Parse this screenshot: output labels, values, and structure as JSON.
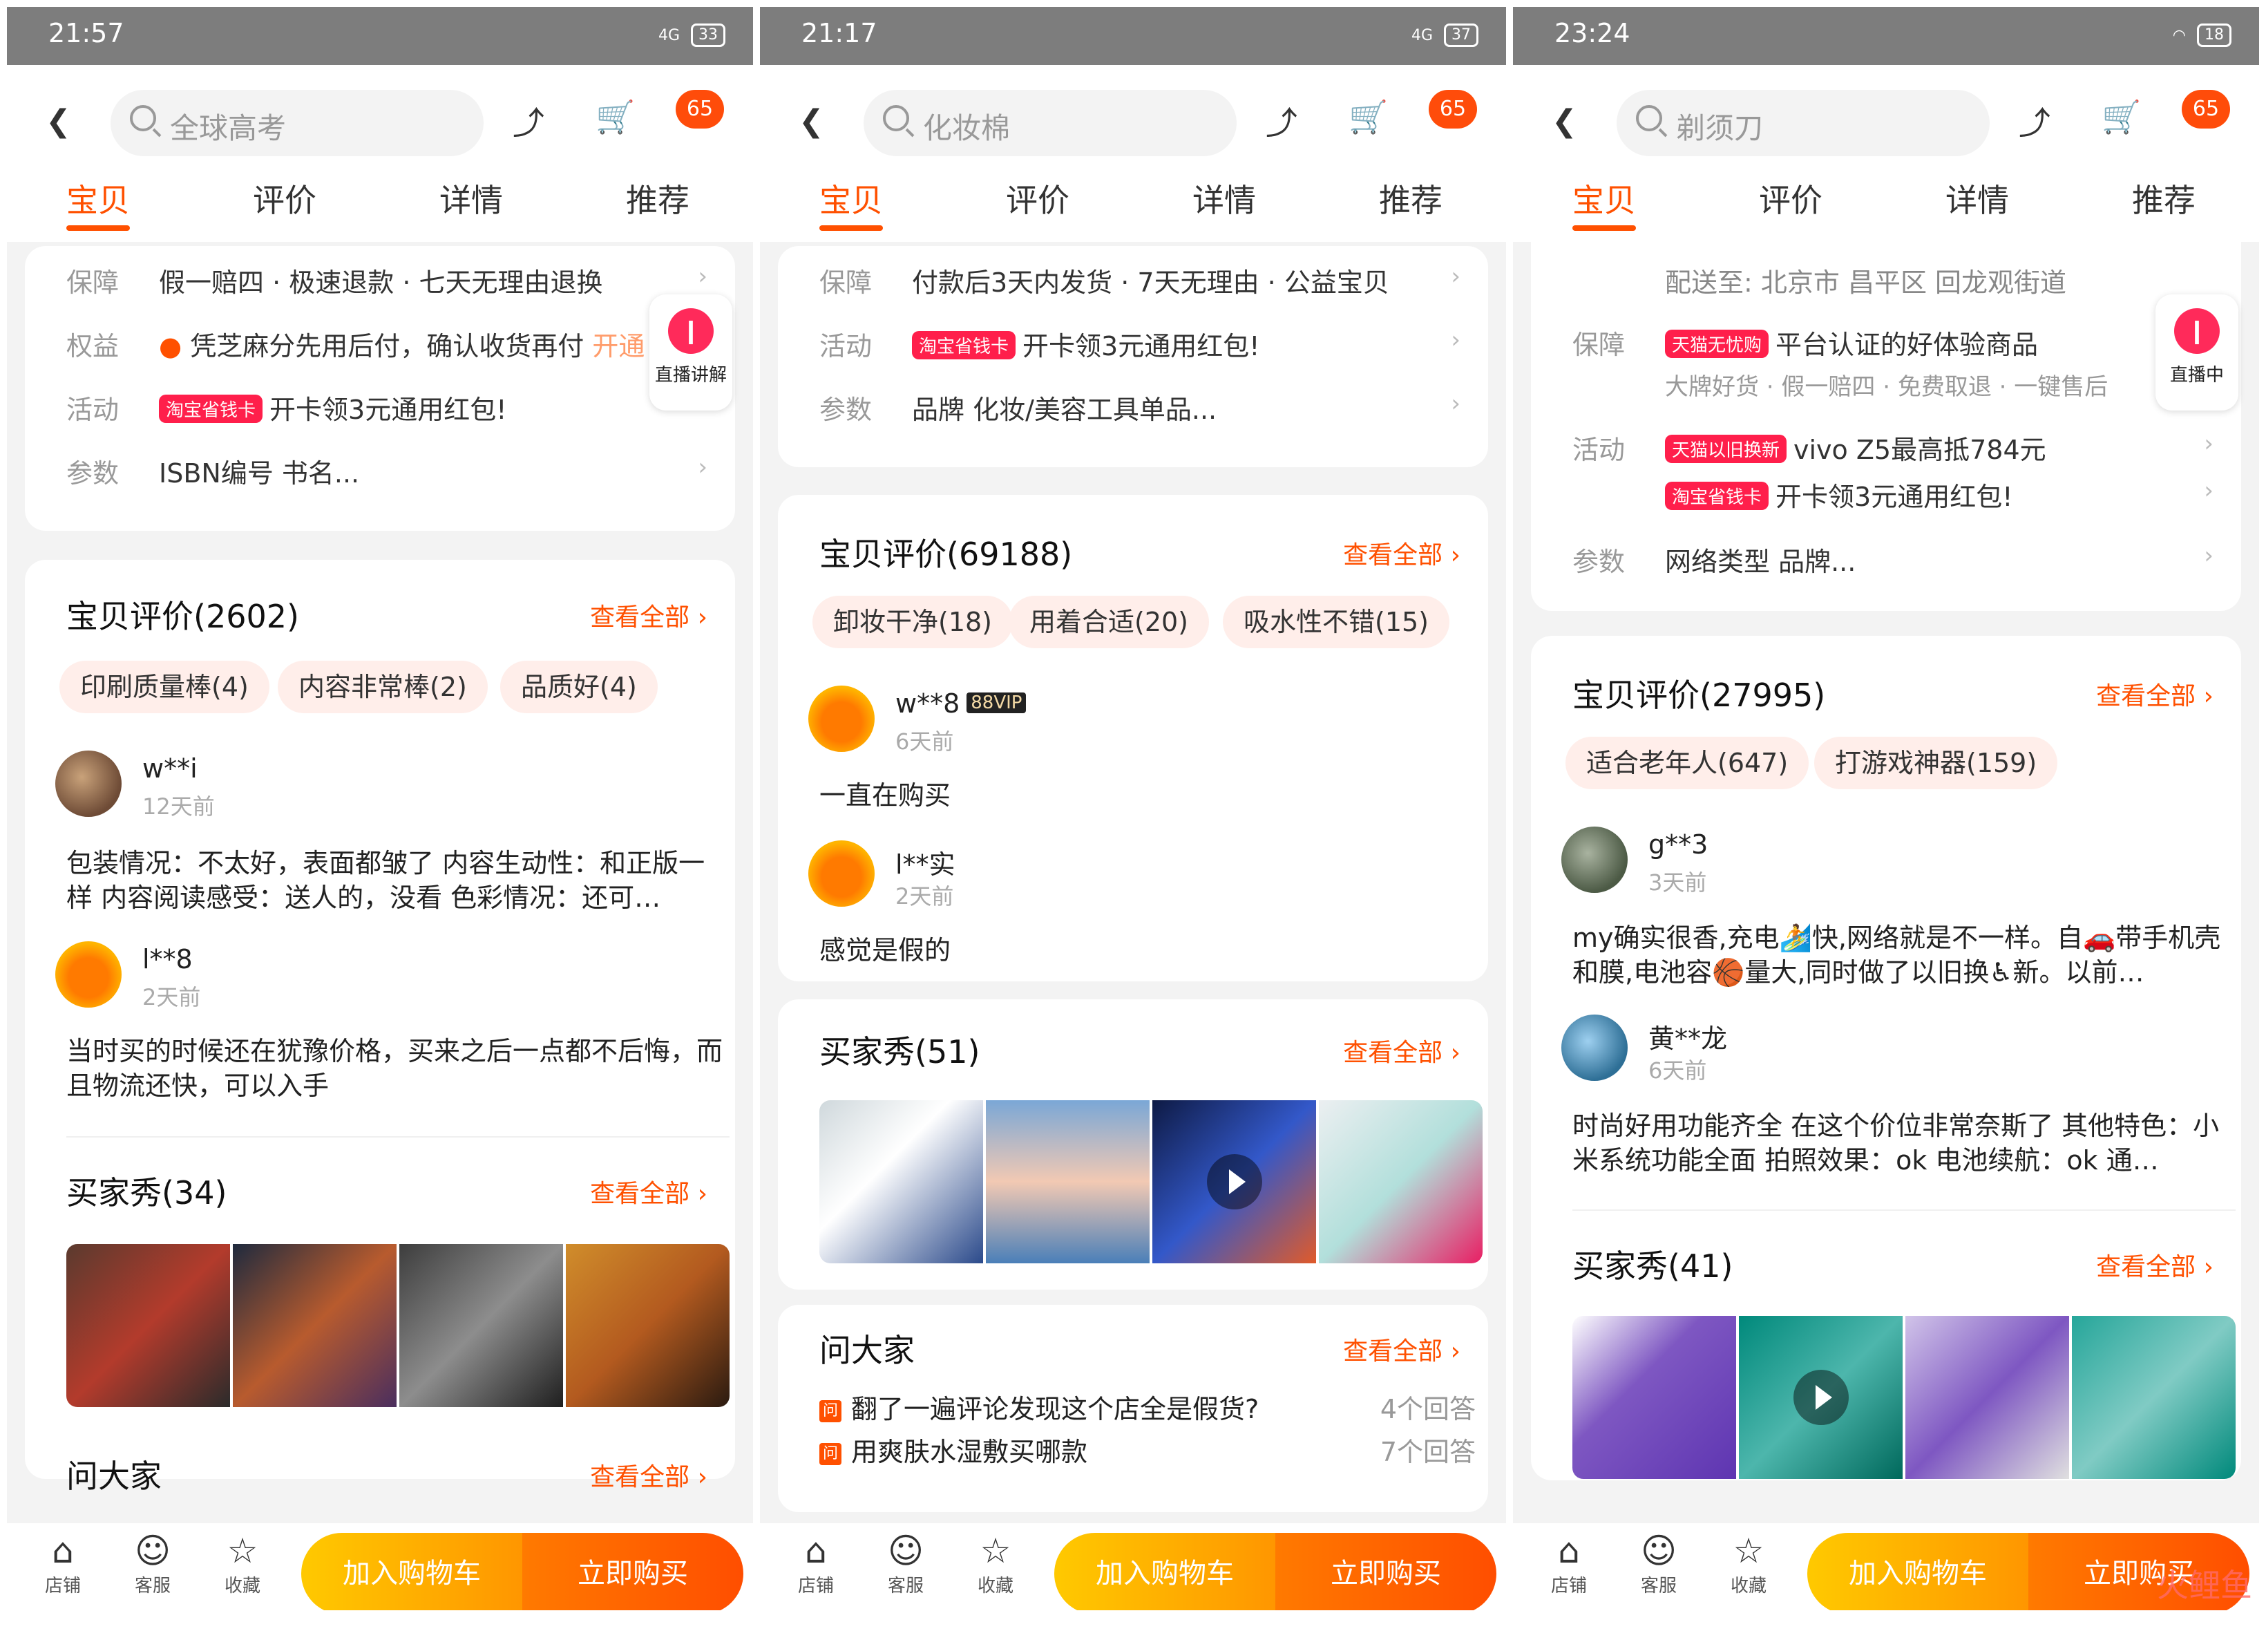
{
  "common": {
    "tabs": [
      "宝贝",
      "评价",
      "详情",
      "推荐"
    ],
    "cart_count": "65",
    "see_all": "查看全部",
    "bottom": {
      "shop": "店铺",
      "service": "客服",
      "fav": "收藏",
      "add_cart": "加入购物车",
      "buy_now": "立即购买"
    },
    "live_label": "直播讲解",
    "live_label2": "直播中",
    "labels": {
      "guarantee": "保障",
      "rights": "权益",
      "activity": "活动",
      "params": "参数"
    },
    "colors": {
      "accent": "#ff5000",
      "status_bar": "#7d7d7d"
    }
  },
  "phone1": {
    "time": "21:57",
    "battery": "33",
    "net": "4G",
    "search_placeholder": "全球高考",
    "guarantee": "假一赔四 · 极速退款 · 七天无理由退换",
    "rights": "凭芝麻分先用后付，确认收货再付",
    "rights_extra": "开通",
    "activity_tag": "淘宝省钱卡",
    "activity": "开卡领3元通用红包!",
    "params": "ISBN编号 书名...",
    "reviews_title": "宝贝评价(2602)",
    "chips": [
      "印刷质量棒(4)",
      "内容非常棒(2)",
      "品质好(4)"
    ],
    "r1_user": "w**i",
    "r1_date": "12天前",
    "r1_text": "包装情况：不太好，表面都皱了 内容生动性：和正版一样 内容阅读感受：送人的，没看 色彩情况：还可…",
    "r2_user": "l**8",
    "r2_date": "2天前",
    "r2_text": "当时买的时候还在犹豫价格，买来之后一点都不后悔，而且物流还快，可以入手",
    "show_title": "买家秀(34)",
    "qa_title": "问大家"
  },
  "phone2": {
    "time": "21:17",
    "battery": "37",
    "net": "4G",
    "search_placeholder": "化妆棉",
    "guarantee": "付款后3天内发货 · 7天无理由 · 公益宝贝",
    "activity_tag": "淘宝省钱卡",
    "activity": "开卡领3元通用红包!",
    "params": "品牌 化妆/美容工具单品...",
    "reviews_title": "宝贝评价(69188)",
    "chips": [
      "卸妆干净(18)",
      "用着合适(20)",
      "吸水性不错(15)"
    ],
    "r1_user": "w**8",
    "r1_vip": "88VIP",
    "r1_date": "6天前",
    "r1_text": "一直在购买",
    "r2_user": "l**实",
    "r2_date": "2天前",
    "r2_text": "感觉是假的",
    "show_title": "买家秀(51)",
    "qa_title": "问大家",
    "qa_mark": "问",
    "qa": [
      {
        "q": "翻了一遍评论发现这个店全是假货?",
        "count": "4个回答"
      },
      {
        "q": "用爽肤水湿敷买哪款",
        "count": "7个回答"
      }
    ]
  },
  "phone3": {
    "time": "23:24",
    "battery": "18",
    "net": "4G",
    "search_placeholder": "剃须刀",
    "delivery": "配送至: 北京市 昌平区 回龙观街道",
    "guarantee_tag": "天猫无忧购",
    "guarantee": "平台认证的好体验商品",
    "guarantee_sub": "大牌好货 · 假一赔四 · 免费取退 · 一键售后",
    "activity1_tag": "天猫以旧换新",
    "activity1": "vivo Z5最高抵784元",
    "activity2_tag": "淘宝省钱卡",
    "activity2": "开卡领3元通用红包!",
    "params": "网络类型 品牌...",
    "reviews_title": "宝贝评价(27995)",
    "chips": [
      "适合老年人(647)",
      "打游戏神器(159)"
    ],
    "r1_user": "g**3",
    "r1_date": "3天前",
    "r1_text": "my确实很香,充电🏄快,网络就是不一样。自🚗带手机壳和膜,电池容🏀量大,同时做了以旧换♿新。以前…",
    "r2_user": "黄**龙",
    "r2_date": "6天前",
    "r2_text": "时尚好用功能齐全 在这个价位非常奈斯了 其他特色：小米系统功能全面 拍照效果：ok 电池续航：ok 通…",
    "show_title": "买家秀(41)"
  },
  "watermark": "火鲤鱼"
}
